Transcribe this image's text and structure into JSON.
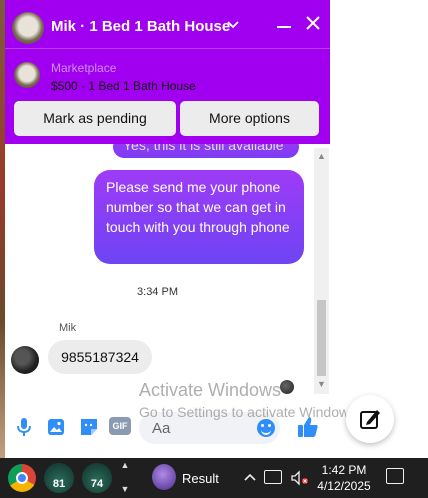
{
  "header": {
    "title": "Mik · 1 Bed 1 Bath House",
    "chevron": "chevron-down-icon",
    "minimize": "minimize-icon",
    "close": "close-icon",
    "color": "#a100f0"
  },
  "listing": {
    "label": "Marketplace",
    "title": "$500 · 1 Bed 1 Bath House",
    "actions": {
      "mark_pending": "Mark as pending",
      "more_options": "More options"
    }
  },
  "messages": {
    "outgoing_partial": "Yes, this it is still available",
    "outgoing_main": "Please send me your phone number so that we can get in touch with you through phone",
    "timestamp": "3:34 PM",
    "sender_name": "Mik",
    "incoming": "9855187324"
  },
  "composer": {
    "placeholder": "Aa",
    "gif_label": "GIF",
    "icons": [
      "microphone-icon",
      "photo-icon",
      "sticker-icon",
      "gif-icon",
      "emoji-icon",
      "thumbs-up-icon"
    ]
  },
  "watermark": {
    "line1": "Activate Windows",
    "line2": "Go to Settings to activate Windows."
  },
  "taskbar": {
    "gauge1": "81",
    "gauge2": "74",
    "result_label": "Result",
    "time": "1:42 PM",
    "date": "4/12/2025"
  }
}
